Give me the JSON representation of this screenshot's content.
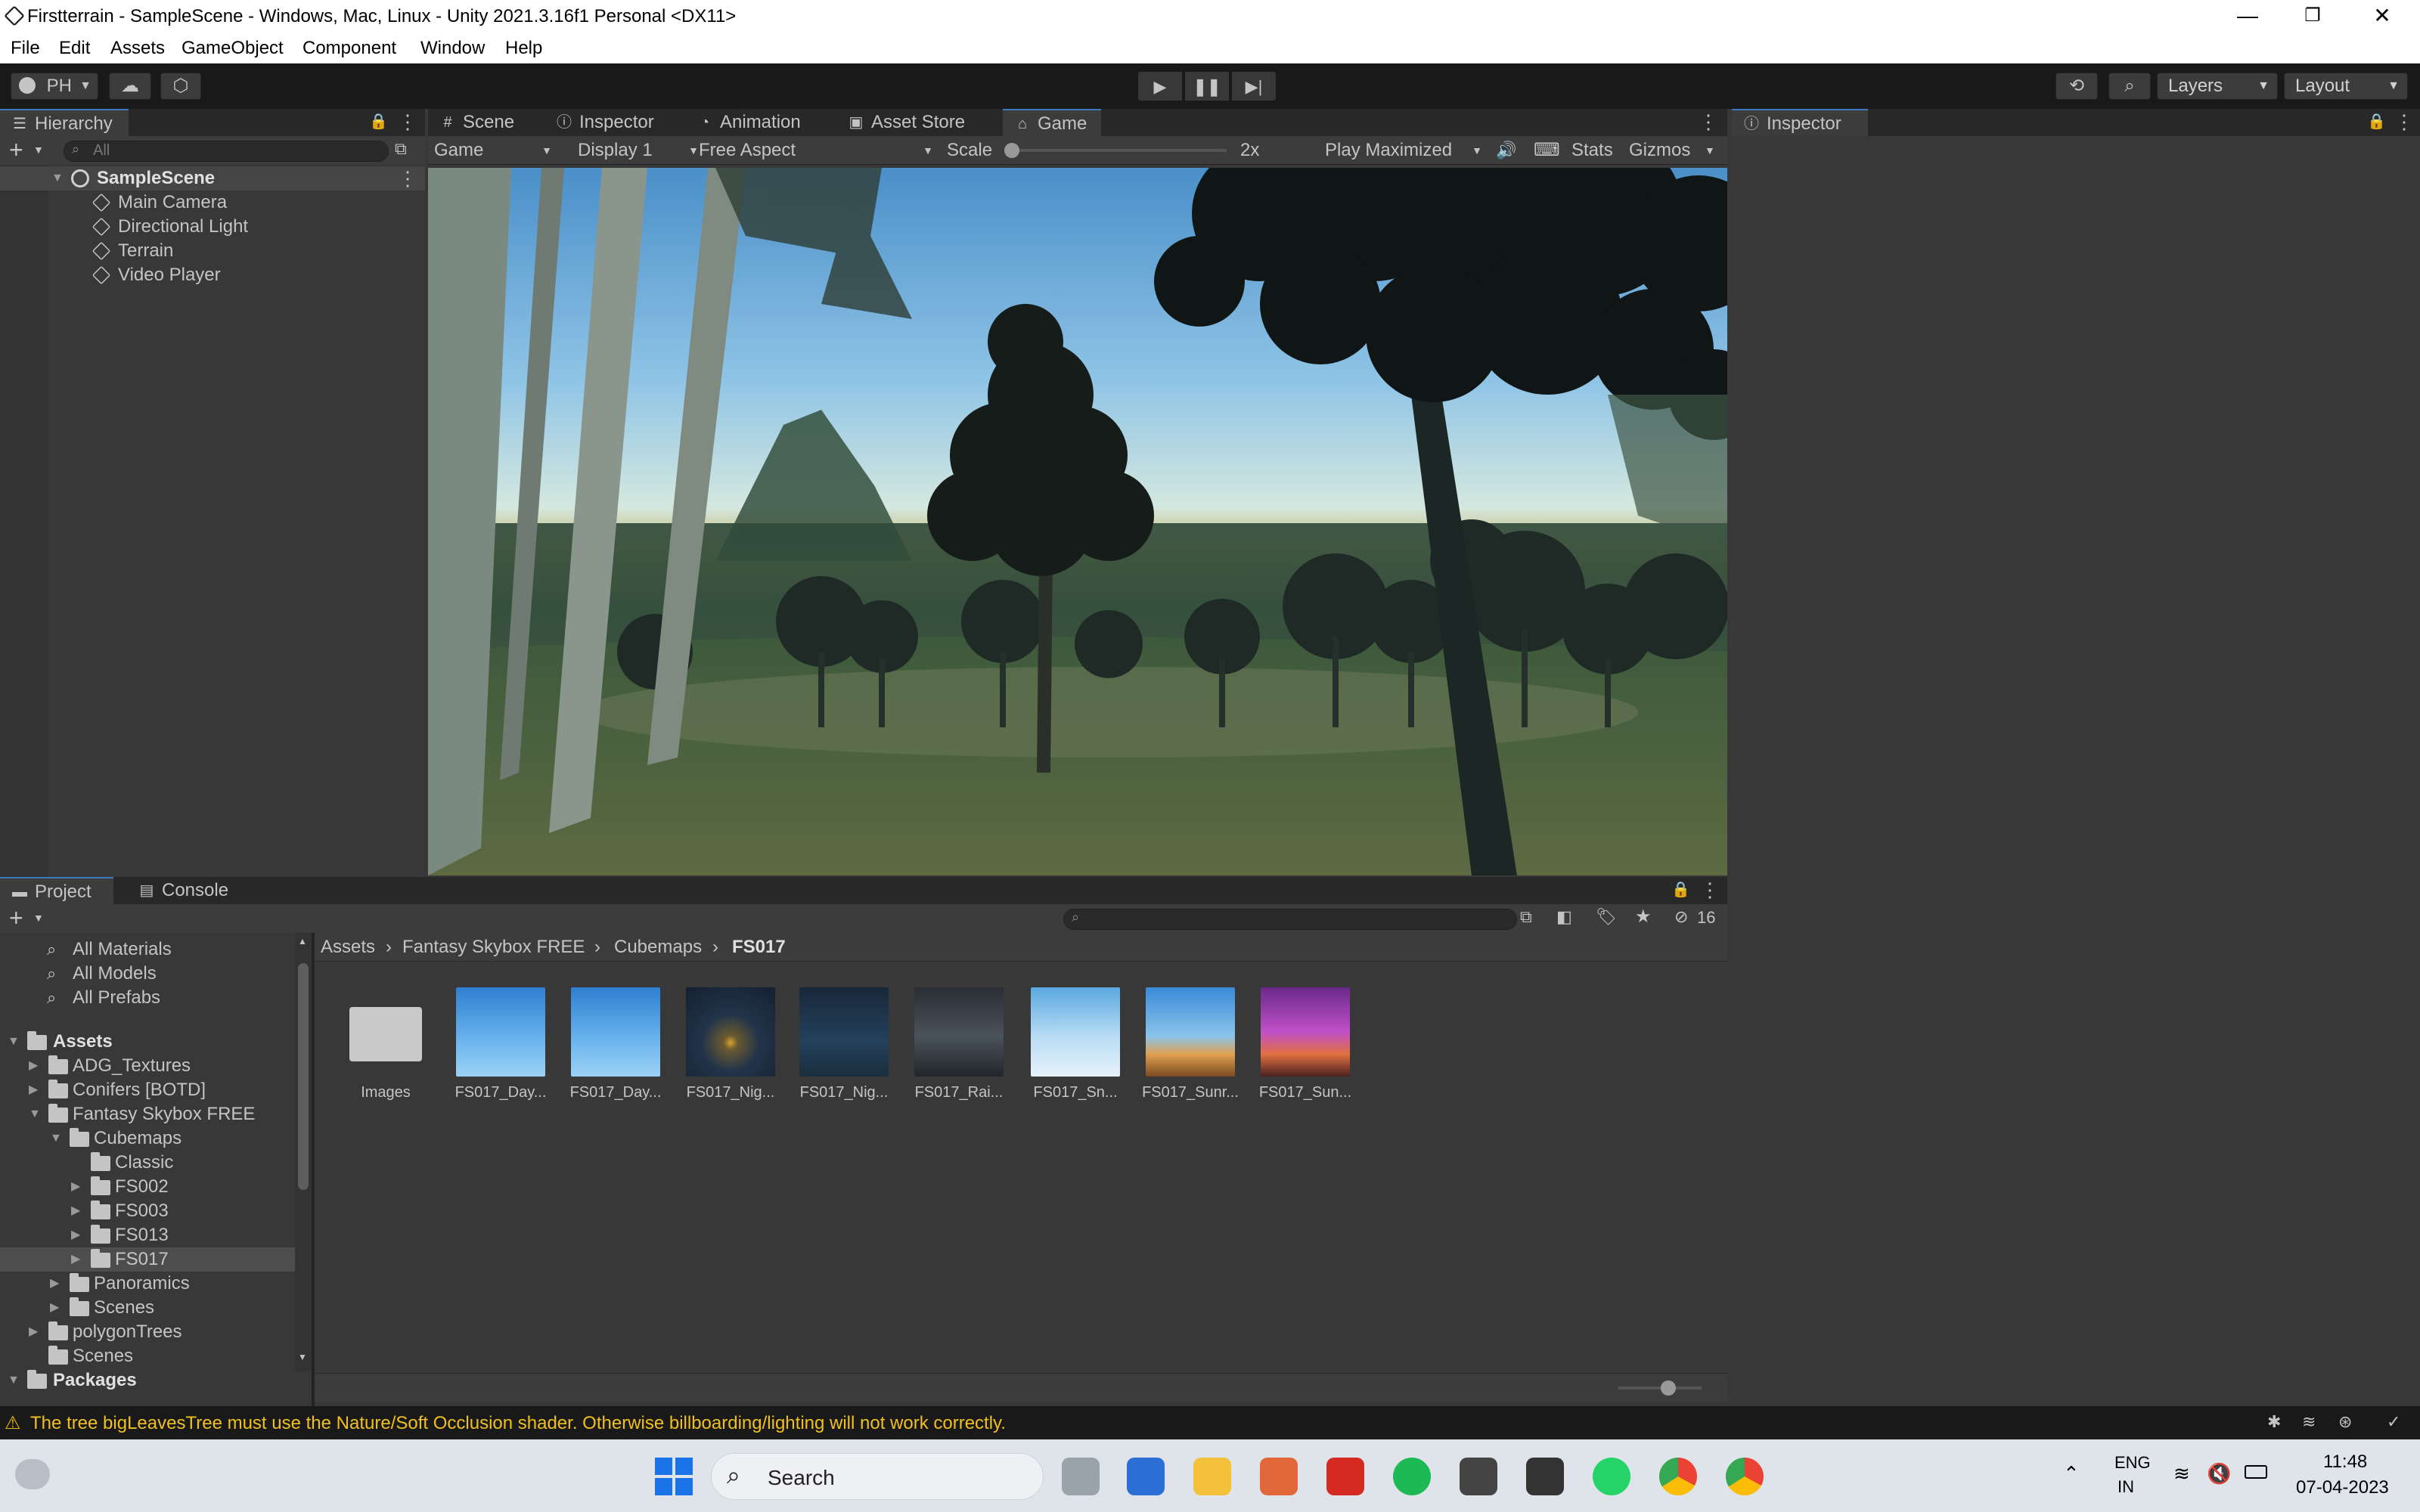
{
  "window": {
    "title": "Firstterrain - SampleScene - Windows, Mac, Linux - Unity 2021.3.16f1 Personal <DX11>",
    "controls": [
      "—",
      "❐",
      "✕"
    ]
  },
  "menu": [
    "File",
    "Edit",
    "Assets",
    "GameObject",
    "Component",
    "Window",
    "Help"
  ],
  "toolbar": {
    "account": "PH",
    "layers": "Layers",
    "layout": "Layout"
  },
  "hierarchy": {
    "tab": "Hierarchy",
    "search_placeholder": "All",
    "scene": "SampleScene",
    "items": [
      "Main Camera",
      "Directional Light",
      "Terrain",
      "Video Player"
    ]
  },
  "center_tabs": [
    "Scene",
    "Inspector",
    "Animation",
    "Asset Store",
    "Game"
  ],
  "game_controls": {
    "view": "Game",
    "display": "Display 1",
    "aspect": "Free Aspect",
    "scale_label": "Scale",
    "scale_value": "2x",
    "play_mode": "Play Maximized",
    "stats": "Stats",
    "gizmos": "Gizmos"
  },
  "inspector": {
    "tab": "Inspector"
  },
  "project": {
    "tabs": [
      "Project",
      "Console"
    ],
    "search_items": [
      "All Materials",
      "All Models",
      "All Prefabs"
    ],
    "tree": {
      "assets": "Assets",
      "items": [
        {
          "label": "ADG_Textures",
          "depth": 1,
          "arrow": "▶"
        },
        {
          "label": "Conifers [BOTD]",
          "depth": 1,
          "arrow": "▶"
        },
        {
          "label": "Fantasy Skybox FREE",
          "depth": 1,
          "arrow": "▼"
        },
        {
          "label": "Cubemaps",
          "depth": 2,
          "arrow": "▼"
        },
        {
          "label": "Classic",
          "depth": 3,
          "arrow": ""
        },
        {
          "label": "FS002",
          "depth": 3,
          "arrow": "▶"
        },
        {
          "label": "FS003",
          "depth": 3,
          "arrow": "▶"
        },
        {
          "label": "FS013",
          "depth": 3,
          "arrow": "▶"
        },
        {
          "label": "FS017",
          "depth": 3,
          "arrow": "▶"
        },
        {
          "label": "Panoramics",
          "depth": 2,
          "arrow": "▶"
        },
        {
          "label": "Scenes",
          "depth": 2,
          "arrow": "▶"
        },
        {
          "label": "polygonTrees",
          "depth": 1,
          "arrow": "▶"
        },
        {
          "label": "Scenes",
          "depth": 1,
          "arrow": ""
        }
      ],
      "packages": "Packages"
    },
    "breadcrumb": [
      "Assets",
      "Fantasy Skybox FREE",
      "Cubemaps",
      "FS017"
    ],
    "hidden_count": "16",
    "assets": [
      {
        "name": "Images"
      },
      {
        "name": "FS017_Day..."
      },
      {
        "name": "FS017_Day..."
      },
      {
        "name": "FS017_Nig..."
      },
      {
        "name": "FS017_Nig..."
      },
      {
        "name": "FS017_Rai..."
      },
      {
        "name": "FS017_Sn..."
      },
      {
        "name": "FS017_Sunr..."
      },
      {
        "name": "FS017_Sun..."
      }
    ]
  },
  "status": {
    "message": "The tree bigLeavesTree must use the Nature/Soft Occlusion shader. Otherwise billboarding/lighting will not work correctly."
  },
  "taskbar": {
    "search": "Search",
    "lang_top": "ENG",
    "lang_bottom": "IN",
    "time": "11:48",
    "date": "07-04-2023"
  }
}
